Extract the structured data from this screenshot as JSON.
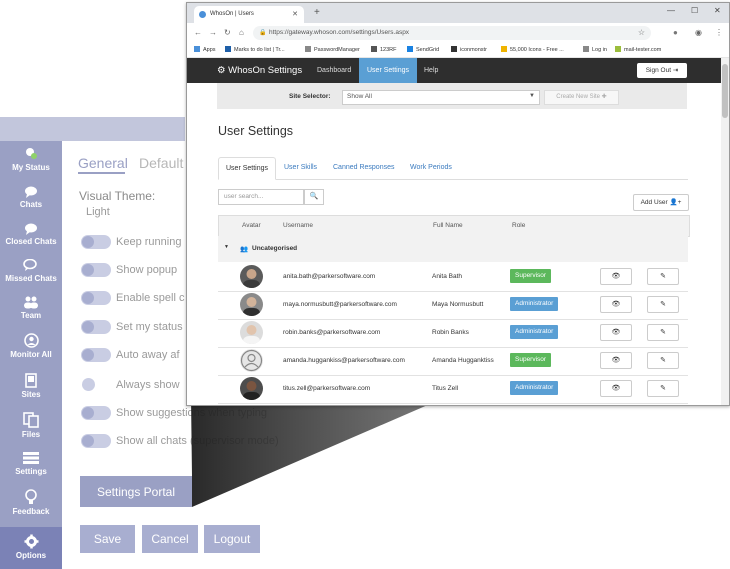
{
  "background_app": {
    "sidebar": [
      {
        "label": "My Status",
        "icon": "status-icon"
      },
      {
        "label": "Chats",
        "icon": "chat-icon"
      },
      {
        "label": "Closed Chats",
        "icon": "closed-chat-icon"
      },
      {
        "label": "Missed Chats",
        "icon": "missed-chat-icon"
      },
      {
        "label": "Team",
        "icon": "team-icon"
      },
      {
        "label": "Monitor All",
        "icon": "monitor-icon"
      },
      {
        "label": "Sites",
        "icon": "sites-icon"
      },
      {
        "label": "Files",
        "icon": "files-icon"
      },
      {
        "label": "Settings",
        "icon": "settings-icon"
      },
      {
        "label": "Feedback",
        "icon": "feedback-icon"
      },
      {
        "label": "Options",
        "icon": "gear-icon"
      }
    ],
    "tabs": [
      "General",
      "Default"
    ],
    "visual_theme_label": "Visual Theme:",
    "visual_theme_value": "Light",
    "options": [
      "Keep running",
      "Show popup",
      "Enable spell c",
      "Set my status",
      "Auto away af",
      "Always show",
      "Show suggestions when typing",
      "Show all chats (supervisor mode)"
    ],
    "settings_portal_button": "Settings Portal",
    "buttons": {
      "save": "Save",
      "cancel": "Cancel",
      "logout": "Logout"
    },
    "colors": {
      "sidebar": "#9aa0c4",
      "accent": "#7b82b6"
    }
  },
  "browser": {
    "tab_title": "WhosOn | Users",
    "url": "https://gateway.whoson.com/settings/Users.aspx",
    "bookmarks": [
      "Apps",
      "Marks to do list | Tr...",
      "PasswordManager",
      "123RF",
      "SendGrid",
      "iconmonstr",
      "55,000 Icons - Free ...",
      "Log in",
      "mail-tester.com"
    ]
  },
  "page": {
    "brand": "WhosOn Settings",
    "nav": [
      "Dashboard",
      "User Settings",
      "Help"
    ],
    "sign_out": "Sign Out",
    "site_selector_label": "Site Selector:",
    "site_selector_value": "Show All",
    "new_site_button": "Create New Site",
    "heading": "User Settings",
    "tabs": [
      "User Settings",
      "User Skills",
      "Canned Responses",
      "Work Periods"
    ],
    "search_placeholder": "user search...",
    "add_user_button": "Add User",
    "columns": [
      "Avatar",
      "Username",
      "Full Name",
      "Role"
    ],
    "group": "Uncategorised",
    "users": [
      {
        "email": "anita.bath@parkersoftware.com",
        "name": "Anita Bath",
        "role": "Supervisor"
      },
      {
        "email": "maya.normusbutt@parkersoftware.com",
        "name": "Maya Normusbutt",
        "role": "Administrator"
      },
      {
        "email": "robin.banks@parkersoftware.com",
        "name": "Robin Banks",
        "role": "Administrator"
      },
      {
        "email": "amanda.huggankiss@parkersoftware.com",
        "name": "Amanda Hugganktiss",
        "role": "Supervisor"
      },
      {
        "email": "titus.zell@parkersoftware.com",
        "name": "Titus Zell",
        "role": "Administrator"
      }
    ],
    "colors": {
      "navbar": "#2e2e2e",
      "active_nav": "#5a9fd4",
      "supervisor": "#5cb85c",
      "administrator": "#5a9fd4"
    }
  }
}
